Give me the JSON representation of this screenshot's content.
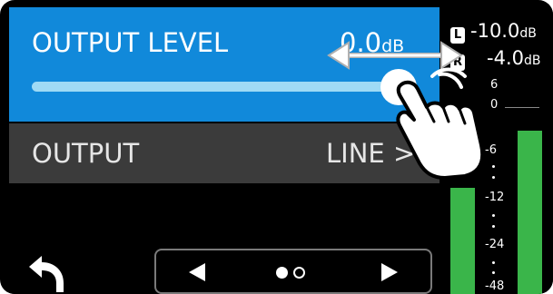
{
  "output_level": {
    "label": "OUTPUT LEVEL",
    "value": "0.0",
    "unit": "dB",
    "level_fraction": 1.0
  },
  "output": {
    "label": "OUTPUT",
    "value": "LINE",
    "chevron": ">"
  },
  "nav": {
    "back_icon": "back-arrow-icon",
    "pages": 2,
    "current_page": 1
  },
  "meter": {
    "left_badge": "L",
    "right_badge": "R",
    "left_peak": "-10.0",
    "right_peak": "-4.0",
    "peak_unit": "dB",
    "ticks": [
      "6",
      "0",
      "-6",
      "-12",
      "-24",
      "-48"
    ],
    "left_level_fraction": 0.37,
    "right_level_fraction": 0.57,
    "bar_color": "#3ab54a"
  },
  "colors": {
    "accent": "#1189da",
    "row_bg": "#3b3b3b",
    "slider_track": "#9fdaf5"
  },
  "overlay": {
    "gesture": "swipe-left-right",
    "hand_icon": "pointing-hand-icon"
  }
}
